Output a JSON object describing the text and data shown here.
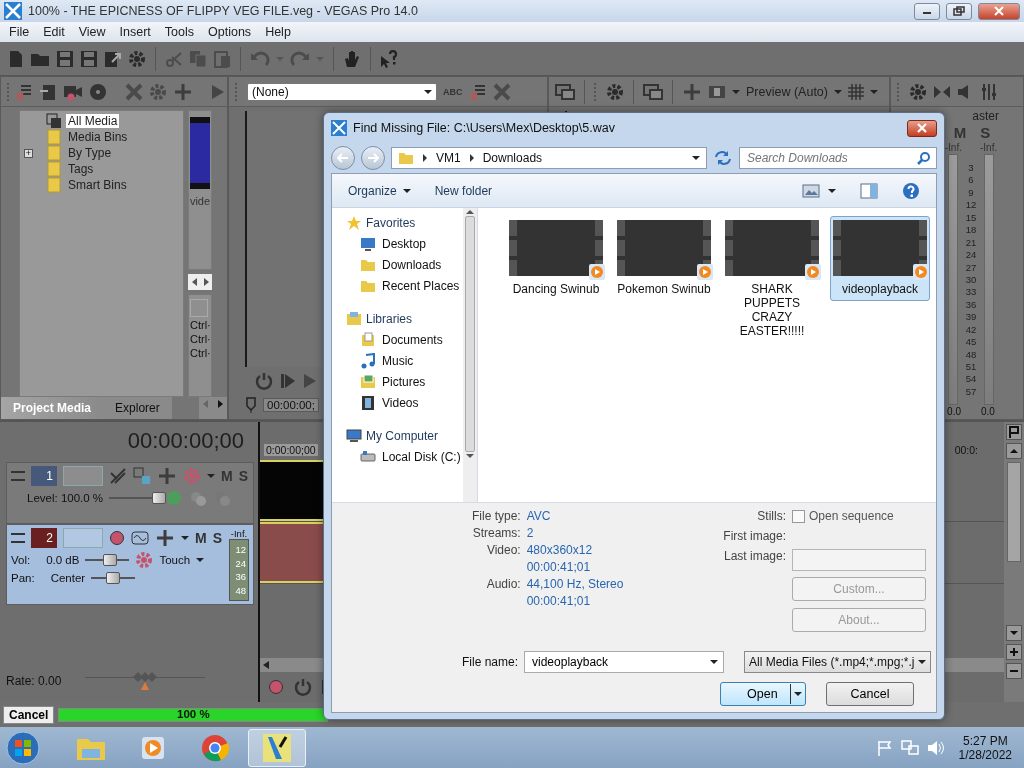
{
  "window": {
    "title": "100% - THE EPICNESS OF FLIPPY VEG FILE.veg - VEGAS Pro 14.0"
  },
  "menu": [
    "File",
    "Edit",
    "View",
    "Insert",
    "Tools",
    "Options",
    "Help"
  ],
  "media_panel": {
    "tree": [
      {
        "label": "All Media",
        "selected": true
      },
      {
        "label": "Media Bins",
        "selected": false
      },
      {
        "label": "By Type",
        "selected": false,
        "expander": "+"
      },
      {
        "label": "Tags",
        "selected": false
      },
      {
        "label": "Smart Bins",
        "selected": false
      }
    ],
    "thumbnail_label": "vide",
    "shortcuts": [
      "Ctrl·",
      "Ctrl·",
      "Ctrl·"
    ],
    "tabs": [
      {
        "label": "Project Media",
        "selected": true
      },
      {
        "label": "Explorer",
        "selected": false
      }
    ]
  },
  "preview": {
    "preset": "(None)",
    "abc": "ABC",
    "timecode": "00:00:00;"
  },
  "trimmer": {
    "mode": "Preview (Auto)"
  },
  "master": {
    "title": "aster",
    "mute": "M",
    "solo": "S",
    "peaks": [
      "-Inf.",
      "-Inf."
    ],
    "scale": [
      "3",
      "6",
      "9",
      "12",
      "15",
      "18",
      "21",
      "24",
      "27",
      "30",
      "33",
      "36",
      "39",
      "42",
      "45",
      "48",
      "51",
      "54",
      "57"
    ],
    "readings": [
      "0.0",
      "0.0"
    ]
  },
  "timeline": {
    "time": "00:00:00;00",
    "ruler_start": "0:00:00;00",
    "ruler_end": "00:0:",
    "rate": {
      "label": "Rate: 0.00",
      "level": 0.5
    }
  },
  "tracks": [
    {
      "kind": "video",
      "number": "1",
      "selected": false,
      "mute": "M",
      "solo": "S",
      "level_label": "Level: 100.0 %",
      "level": 1.0
    },
    {
      "kind": "audio",
      "number": "2",
      "selected": true,
      "mute": "M",
      "solo": "S",
      "peak": "-Inf.",
      "meter_scale": [
        "12",
        "24",
        "36",
        "48"
      ],
      "vol_label": "Vol:",
      "vol": {
        "text": "0.0 dB",
        "level": 0.55
      },
      "pan_label": "Pan:",
      "pan": {
        "text": "Center",
        "level": 0.5
      },
      "automation": "Touch"
    }
  ],
  "status": {
    "cancel": "Cancel",
    "progress": "100 %",
    "level": 1.0
  },
  "dialog": {
    "title": "Find Missing File: C:\\Users\\Mex\\Desktop\\5.wav",
    "breadcrumb": [
      "VM1",
      "Downloads"
    ],
    "search_placeholder": "Search Downloads",
    "organize": "Organize",
    "new_folder": "New folder",
    "nav": [
      {
        "label": "Favorites",
        "kind": "star",
        "children": [
          {
            "label": "Desktop",
            "kind": "desktop"
          },
          {
            "label": "Downloads",
            "kind": "folder"
          },
          {
            "label": "Recent Places",
            "kind": "folder"
          }
        ]
      },
      {
        "label": "Libraries",
        "kind": "library",
        "children": [
          {
            "label": "Documents",
            "kind": "document"
          },
          {
            "label": "Music",
            "kind": "music"
          },
          {
            "label": "Pictures",
            "kind": "picture"
          },
          {
            "label": "Videos",
            "kind": "video"
          }
        ]
      },
      {
        "label": "My Computer",
        "kind": "computer",
        "children": [
          {
            "label": "Local Disk (C:)",
            "kind": "disk"
          }
        ]
      }
    ],
    "files": [
      {
        "name": "Dancing Swinub",
        "selected": false
      },
      {
        "name": "Pokemon Swinub",
        "selected": false
      },
      {
        "name": "SHARK PUPPETS CRAZY EASTER!!!!!",
        "selected": false
      },
      {
        "name": "videoplayback",
        "selected": true
      }
    ],
    "details": [
      {
        "label": "File type:",
        "values": [
          "AVC"
        ]
      },
      {
        "label": "Streams:",
        "values": [
          "2"
        ]
      },
      {
        "label": "Video:",
        "values": [
          "480x360x12",
          "00:00:41;01"
        ]
      },
      {
        "label": "Audio:",
        "values": [
          "44,100 Hz, Stereo",
          "00:00:41;01"
        ]
      }
    ],
    "stills": {
      "label": "Stills:",
      "option": "Open sequence",
      "checked": false
    },
    "first_image": "First image:",
    "last_image": "Last image:",
    "side_buttons": [
      {
        "label": "Custom...",
        "disabled": true
      },
      {
        "label": "About...",
        "disabled": true
      }
    ],
    "file_name_label": "File name:",
    "file_name": "videoplayback",
    "filter": "All Media Files (*.mp4;*.mpg;*.j",
    "open": "Open",
    "cancel": "Cancel"
  },
  "taskbar": {
    "apps": [
      {
        "kind": "folder",
        "selected": false
      },
      {
        "kind": "player",
        "selected": false
      },
      {
        "kind": "browser",
        "selected": false
      },
      {
        "kind": "editor",
        "selected": true
      }
    ],
    "time": "5:27 PM",
    "date": "1/28/2022"
  }
}
